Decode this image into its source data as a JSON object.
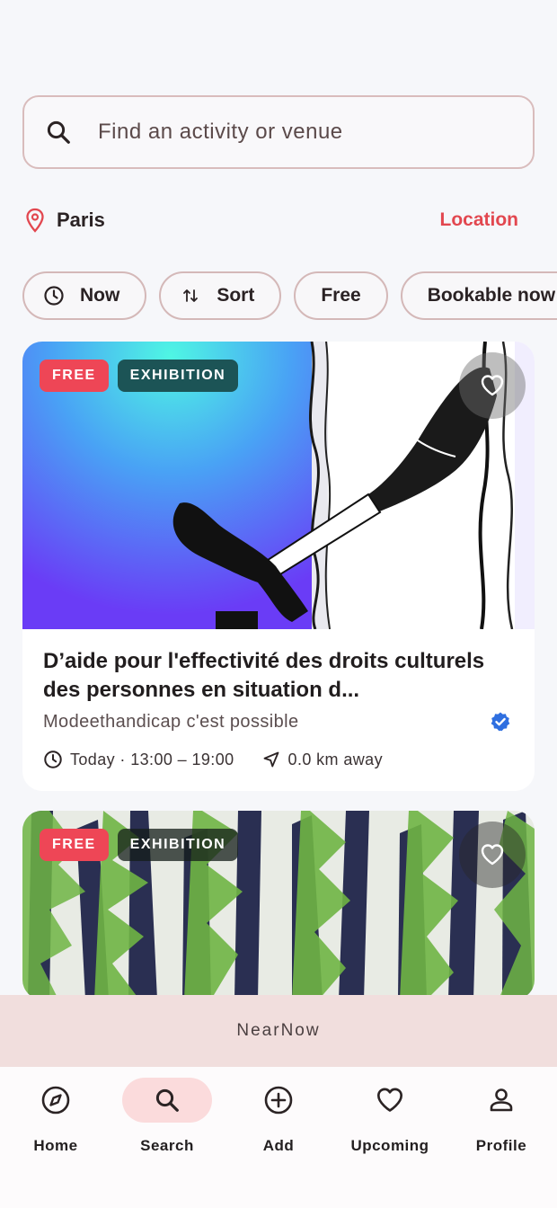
{
  "search": {
    "placeholder": "Find an activity or venue"
  },
  "location": {
    "city": "Paris",
    "button_label": "Location"
  },
  "filters": [
    {
      "label": "Now",
      "icon": "clock-icon"
    },
    {
      "label": "Sort",
      "icon": "sort-arrows-icon"
    },
    {
      "label": "Free"
    },
    {
      "label": "Bookable now"
    }
  ],
  "events": [
    {
      "badges": [
        "FREE",
        "EXHIBITION"
      ],
      "title": "D’aide pour l'effectivité des droits culturels des personnes en situation d...",
      "organizer": "Modeethandicap c'est possible",
      "verified": true,
      "time": "Today · 13:00 – 19:00",
      "distance": "0.0 km away",
      "favorited": false
    },
    {
      "badges": [
        "FREE",
        "EXHIBITION"
      ],
      "favorited": false
    }
  ],
  "toast": {
    "text": "NearNow"
  },
  "nav": {
    "items": [
      {
        "label": "Home",
        "icon": "compass-icon"
      },
      {
        "label": "Search",
        "icon": "search-icon",
        "active": true
      },
      {
        "label": "Add",
        "icon": "add-circle-icon"
      },
      {
        "label": "Upcoming",
        "icon": "heart-icon"
      },
      {
        "label": "Profile",
        "icon": "person-icon"
      }
    ]
  },
  "colors": {
    "accent": "#e2474f",
    "free_badge": "#ee4656",
    "exhibition_badge": "#1c5456",
    "nav_active": "#fbdbdc",
    "verified": "#2f6fe0"
  }
}
